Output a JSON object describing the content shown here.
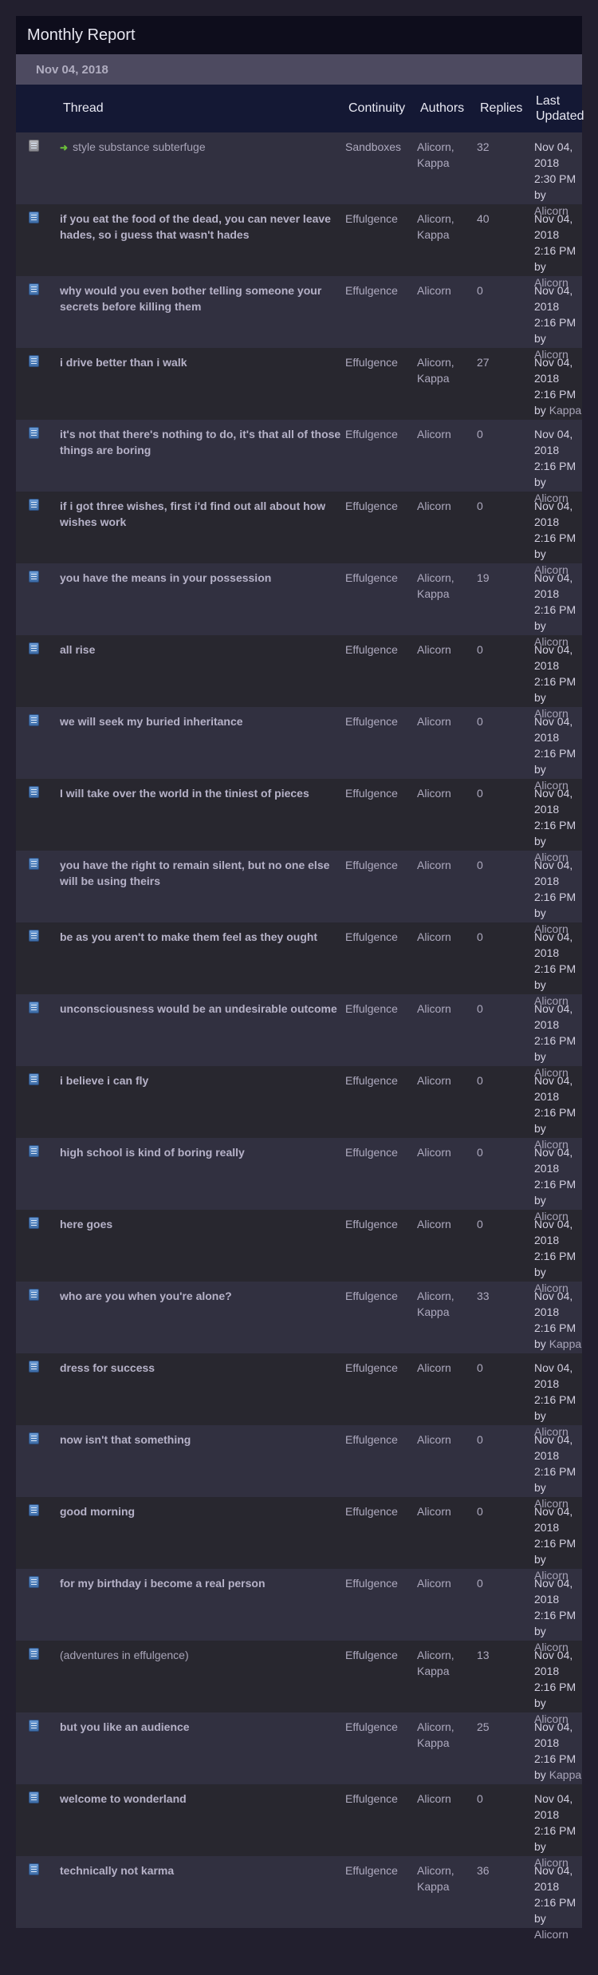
{
  "header": {
    "title": "Monthly Report"
  },
  "date_bar": {
    "label": "Nov 04, 2018"
  },
  "columns": {
    "thread": "Thread",
    "continuity": "Continuity",
    "authors": "Authors",
    "replies": "Replies",
    "last_updated": "Last Updated"
  },
  "colors": {
    "background": "#221f2e",
    "title_bar": "#0e0d1c",
    "date_bar": "#4d4a60",
    "header": "#141834",
    "row_odd": "#313040",
    "row_even": "#28272f",
    "new_arrow": "#6cc03a"
  },
  "rows": [
    {
      "thread": "style substance subterfuge",
      "continuity": "Sandboxes",
      "authors": "Alicorn, Kappa",
      "replies": "32",
      "updated": "Nov 04, 2018 2:30 PM by",
      "by": "Alicorn",
      "icon": "doc-gray-icon",
      "new": true,
      "bold": false
    },
    {
      "thread": "if you eat the food of the dead, you can never leave hades, so i guess that wasn't hades",
      "continuity": "Effulgence",
      "authors": "Alicorn, Kappa",
      "replies": "40",
      "updated": "Nov 04, 2018 2:16 PM by",
      "by": "Alicorn",
      "icon": "doc-icon",
      "new": false,
      "bold": true
    },
    {
      "thread": "why would you even bother telling someone your secrets before killing them",
      "continuity": "Effulgence",
      "authors": "Alicorn",
      "replies": "0",
      "updated": "Nov 04, 2018 2:16 PM by",
      "by": "Alicorn",
      "icon": "doc-icon",
      "new": false,
      "bold": true
    },
    {
      "thread": "i drive better than i walk",
      "continuity": "Effulgence",
      "authors": "Alicorn, Kappa",
      "replies": "27",
      "updated": "Nov 04, 2018 2:16 PM by",
      "by": "Kappa",
      "icon": "doc-icon",
      "new": false,
      "bold": true
    },
    {
      "thread": "it's not that there's nothing to do, it's that all of those things are boring",
      "continuity": "Effulgence",
      "authors": "Alicorn",
      "replies": "0",
      "updated": "Nov 04, 2018 2:16 PM by",
      "by": "Alicorn",
      "icon": "doc-icon",
      "new": false,
      "bold": true
    },
    {
      "thread": "if i got three wishes, first i'd find out all about how wishes work",
      "continuity": "Effulgence",
      "authors": "Alicorn",
      "replies": "0",
      "updated": "Nov 04, 2018 2:16 PM by",
      "by": "Alicorn",
      "icon": "doc-icon",
      "new": false,
      "bold": true
    },
    {
      "thread": "you have the means in your possession",
      "continuity": "Effulgence",
      "authors": "Alicorn, Kappa",
      "replies": "19",
      "updated": "Nov 04, 2018 2:16 PM by",
      "by": "Alicorn",
      "icon": "doc-icon",
      "new": false,
      "bold": true
    },
    {
      "thread": "all rise",
      "continuity": "Effulgence",
      "authors": "Alicorn",
      "replies": "0",
      "updated": "Nov 04, 2018 2:16 PM by",
      "by": "Alicorn",
      "icon": "doc-icon",
      "new": false,
      "bold": true
    },
    {
      "thread": "we will seek my buried inheritance",
      "continuity": "Effulgence",
      "authors": "Alicorn",
      "replies": "0",
      "updated": "Nov 04, 2018 2:16 PM by",
      "by": "Alicorn",
      "icon": "doc-icon",
      "new": false,
      "bold": true
    },
    {
      "thread": "I will take over the world in the tiniest of pieces",
      "continuity": "Effulgence",
      "authors": "Alicorn",
      "replies": "0",
      "updated": "Nov 04, 2018 2:16 PM by",
      "by": "Alicorn",
      "icon": "doc-icon",
      "new": false,
      "bold": true
    },
    {
      "thread": "you have the right to remain silent, but no one else will be using theirs",
      "continuity": "Effulgence",
      "authors": "Alicorn",
      "replies": "0",
      "updated": "Nov 04, 2018 2:16 PM by",
      "by": "Alicorn",
      "icon": "doc-icon",
      "new": false,
      "bold": true
    },
    {
      "thread": "be as you aren't to make them feel as they ought",
      "continuity": "Effulgence",
      "authors": "Alicorn",
      "replies": "0",
      "updated": "Nov 04, 2018 2:16 PM by",
      "by": "Alicorn",
      "icon": "doc-icon",
      "new": false,
      "bold": true
    },
    {
      "thread": "unconsciousness would be an undesirable outcome",
      "continuity": "Effulgence",
      "authors": "Alicorn",
      "replies": "0",
      "updated": "Nov 04, 2018 2:16 PM by",
      "by": "Alicorn",
      "icon": "doc-icon",
      "new": false,
      "bold": true
    },
    {
      "thread": "i believe i can fly",
      "continuity": "Effulgence",
      "authors": "Alicorn",
      "replies": "0",
      "updated": "Nov 04, 2018 2:16 PM by",
      "by": "Alicorn",
      "icon": "doc-icon",
      "new": false,
      "bold": true
    },
    {
      "thread": "high school is kind of boring really",
      "continuity": "Effulgence",
      "authors": "Alicorn",
      "replies": "0",
      "updated": "Nov 04, 2018 2:16 PM by",
      "by": "Alicorn",
      "icon": "doc-icon",
      "new": false,
      "bold": true
    },
    {
      "thread": "here goes",
      "continuity": "Effulgence",
      "authors": "Alicorn",
      "replies": "0",
      "updated": "Nov 04, 2018 2:16 PM by",
      "by": "Alicorn",
      "icon": "doc-icon",
      "new": false,
      "bold": true
    },
    {
      "thread": "who are you when you're alone?",
      "continuity": "Effulgence",
      "authors": "Alicorn, Kappa",
      "replies": "33",
      "updated": "Nov 04, 2018 2:16 PM by",
      "by": "Kappa",
      "icon": "doc-icon",
      "new": false,
      "bold": true
    },
    {
      "thread": "dress for success",
      "continuity": "Effulgence",
      "authors": "Alicorn",
      "replies": "0",
      "updated": "Nov 04, 2018 2:16 PM by",
      "by": "Alicorn",
      "icon": "doc-icon",
      "new": false,
      "bold": true
    },
    {
      "thread": "now isn't that something",
      "continuity": "Effulgence",
      "authors": "Alicorn",
      "replies": "0",
      "updated": "Nov 04, 2018 2:16 PM by",
      "by": "Alicorn",
      "icon": "doc-icon",
      "new": false,
      "bold": true
    },
    {
      "thread": "good morning",
      "continuity": "Effulgence",
      "authors": "Alicorn",
      "replies": "0",
      "updated": "Nov 04, 2018 2:16 PM by",
      "by": "Alicorn",
      "icon": "doc-icon",
      "new": false,
      "bold": true
    },
    {
      "thread": "for my birthday i become a real person",
      "continuity": "Effulgence",
      "authors": "Alicorn",
      "replies": "0",
      "updated": "Nov 04, 2018 2:16 PM by",
      "by": "Alicorn",
      "icon": "doc-icon",
      "new": false,
      "bold": true
    },
    {
      "thread": "(adventures in effulgence)",
      "continuity": "Effulgence",
      "authors": "Alicorn, Kappa",
      "replies": "13",
      "updated": "Nov 04, 2018 2:16 PM by",
      "by": "Alicorn",
      "icon": "doc-icon",
      "new": false,
      "bold": false
    },
    {
      "thread": "but you like an audience",
      "continuity": "Effulgence",
      "authors": "Alicorn, Kappa",
      "replies": "25",
      "updated": "Nov 04, 2018 2:16 PM by",
      "by": "Kappa",
      "icon": "doc-icon",
      "new": false,
      "bold": true
    },
    {
      "thread": "welcome to wonderland",
      "continuity": "Effulgence",
      "authors": "Alicorn",
      "replies": "0",
      "updated": "Nov 04, 2018 2:16 PM by",
      "by": "Alicorn",
      "icon": "doc-icon",
      "new": false,
      "bold": true
    },
    {
      "thread": "technically not karma",
      "continuity": "Effulgence",
      "authors": "Alicorn, Kappa",
      "replies": "36",
      "updated": "Nov 04, 2018 2:16 PM by",
      "by": "Alicorn",
      "icon": "doc-icon",
      "new": false,
      "bold": true
    }
  ]
}
